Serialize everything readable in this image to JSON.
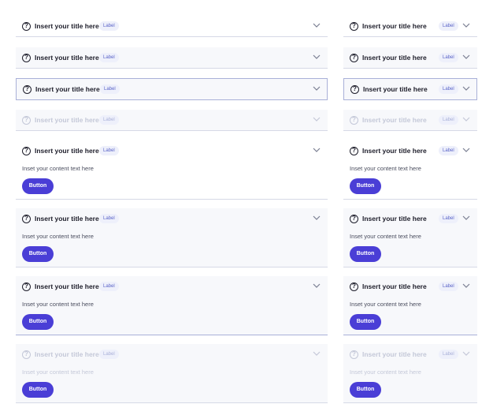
{
  "item": {
    "title": "Insert your title here",
    "label": "Label",
    "content": "Inset your content text here",
    "button": "Button",
    "question_glyph": "?"
  },
  "colors": {
    "primary": "#4a3ed6",
    "badge_bg": "#eef0fb",
    "divider": "#d6d9e6",
    "focus_border": "#a9b0d8",
    "hover_bg": "#f7f8fb"
  },
  "icons": {
    "help": "question-circle-icon",
    "chevron": "chevron-down-icon"
  }
}
